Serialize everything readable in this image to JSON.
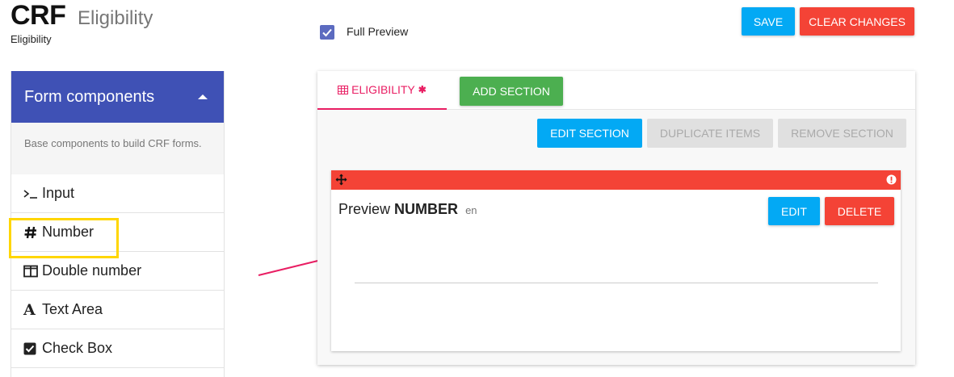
{
  "header": {
    "title": "CRF",
    "subtitle": "Eligibility",
    "small_title": "Eligibility",
    "full_preview_label": "Full Preview",
    "save_label": "SAVE",
    "clear_label": "CLEAR CHANGES"
  },
  "sidebar": {
    "heading": "Form components",
    "description": "Base components to build CRF forms.",
    "items": [
      {
        "label": "Input",
        "icon": "terminal-icon"
      },
      {
        "label": "Number",
        "icon": "hash-icon"
      },
      {
        "label": "Double number",
        "icon": "columns-icon"
      },
      {
        "label": "Text Area",
        "icon": "font-icon"
      },
      {
        "label": "Check Box",
        "icon": "check-square-icon"
      }
    ]
  },
  "main": {
    "tab_label": "ELIGIBILITY",
    "tab_star": "✱",
    "add_section_label": "ADD SECTION",
    "edit_section_label": "EDIT SECTION",
    "duplicate_label": "DUPLICATE ITEMS",
    "remove_section_label": "REMOVE SECTION",
    "card": {
      "preview_prefix": "Preview",
      "preview_type": "NUMBER",
      "preview_lang": "en",
      "edit_label": "EDIT",
      "delete_label": "DELETE"
    }
  },
  "colors": {
    "primary": "#3f51b5",
    "info": "#03a9f4",
    "danger": "#f44336",
    "success": "#4caf50",
    "accent": "#e91e63",
    "highlight": "#ffd600"
  }
}
